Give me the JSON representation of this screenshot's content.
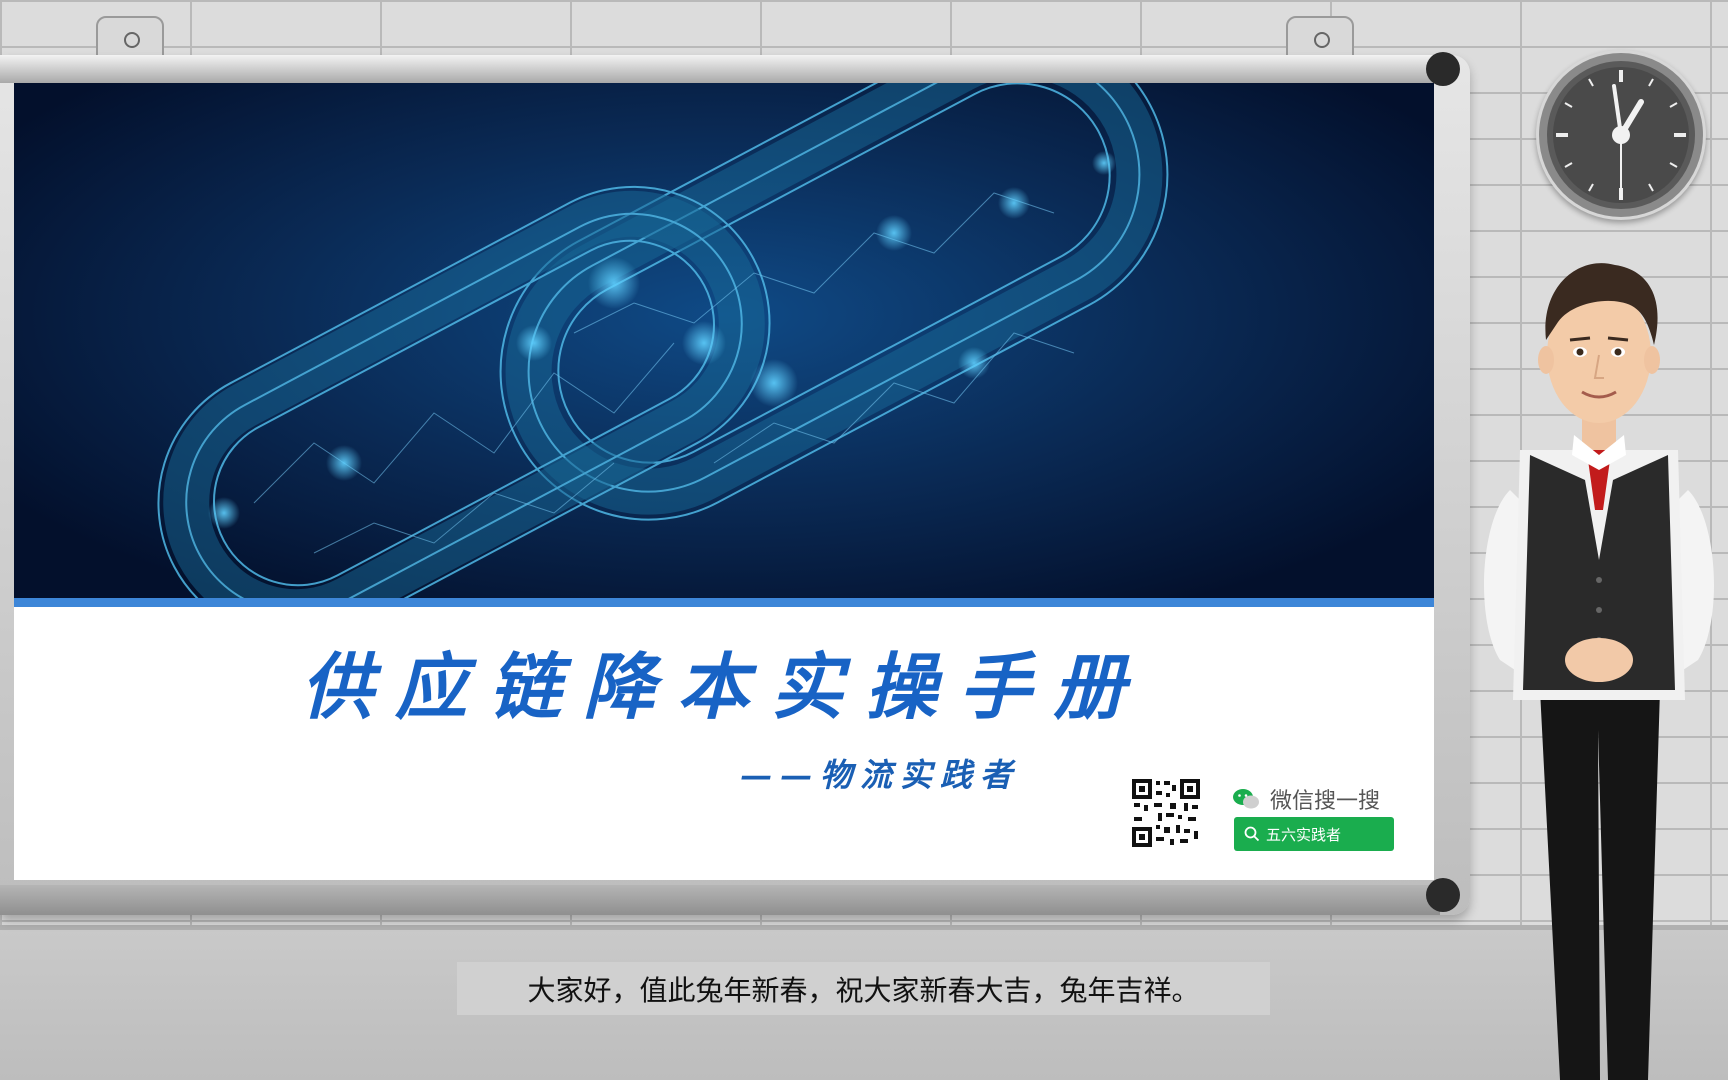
{
  "slide": {
    "title": "供应链降本实操手册",
    "subtitle": "——物流实践者",
    "wechat_search_label": "微信搜一搜",
    "search_button_label": "五六实践者"
  },
  "caption": {
    "text": "大家好，值此兔年新春，祝大家新春大吉，兔年吉祥。"
  },
  "colors": {
    "title_blue": "#1863c5",
    "banner_line": "#3d86d8",
    "wechat_green": "#1aad4e"
  },
  "icons": [
    "clock-icon",
    "wechat-icon",
    "search-icon",
    "qr-code",
    "chain-link-graphic",
    "presenter-avatar"
  ]
}
